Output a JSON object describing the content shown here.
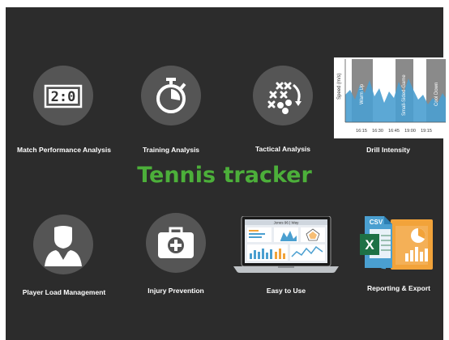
{
  "app": {
    "title": "Tennis tracker",
    "title_color": "#4caf3a"
  },
  "features": [
    {
      "label": "Match Performance Analysis",
      "icon": "scoreboard-icon",
      "scoreboard": "2:0"
    },
    {
      "label": "Training Analysis",
      "icon": "stopwatch-icon"
    },
    {
      "label": "Tactical Analysis",
      "icon": "tactics-icon"
    },
    {
      "label": "Drill Intensity",
      "icon": "intensity-chart-icon"
    },
    {
      "label": "Player Load Management",
      "icon": "player-icon"
    },
    {
      "label": "Injury Prevention",
      "icon": "first-aid-kit-icon"
    },
    {
      "label": "Easy to Use",
      "icon": "laptop-dashboard-icon"
    },
    {
      "label": "Reporting & Export",
      "icon": "csv-excel-icon"
    }
  ],
  "drill_chart": {
    "ylabel": "Speed (m/s)",
    "phases": [
      "Warm Up",
      "Small-Sided-Game",
      "Cool Down"
    ],
    "x_ticks": [
      "16:15",
      "16:30",
      "16:45",
      "19:00",
      "19:15"
    ]
  },
  "laptop_screen": {
    "header_text": "Jones 96 | Way"
  },
  "export": {
    "csv_label": "CSV",
    "excel_letter": "X"
  },
  "colors": {
    "background": "#2c2c2c",
    "circle": "#555555",
    "accent_blue": "#4a9fd0",
    "excel_green": "#1e7145",
    "chart_orange": "#f2a33a"
  }
}
